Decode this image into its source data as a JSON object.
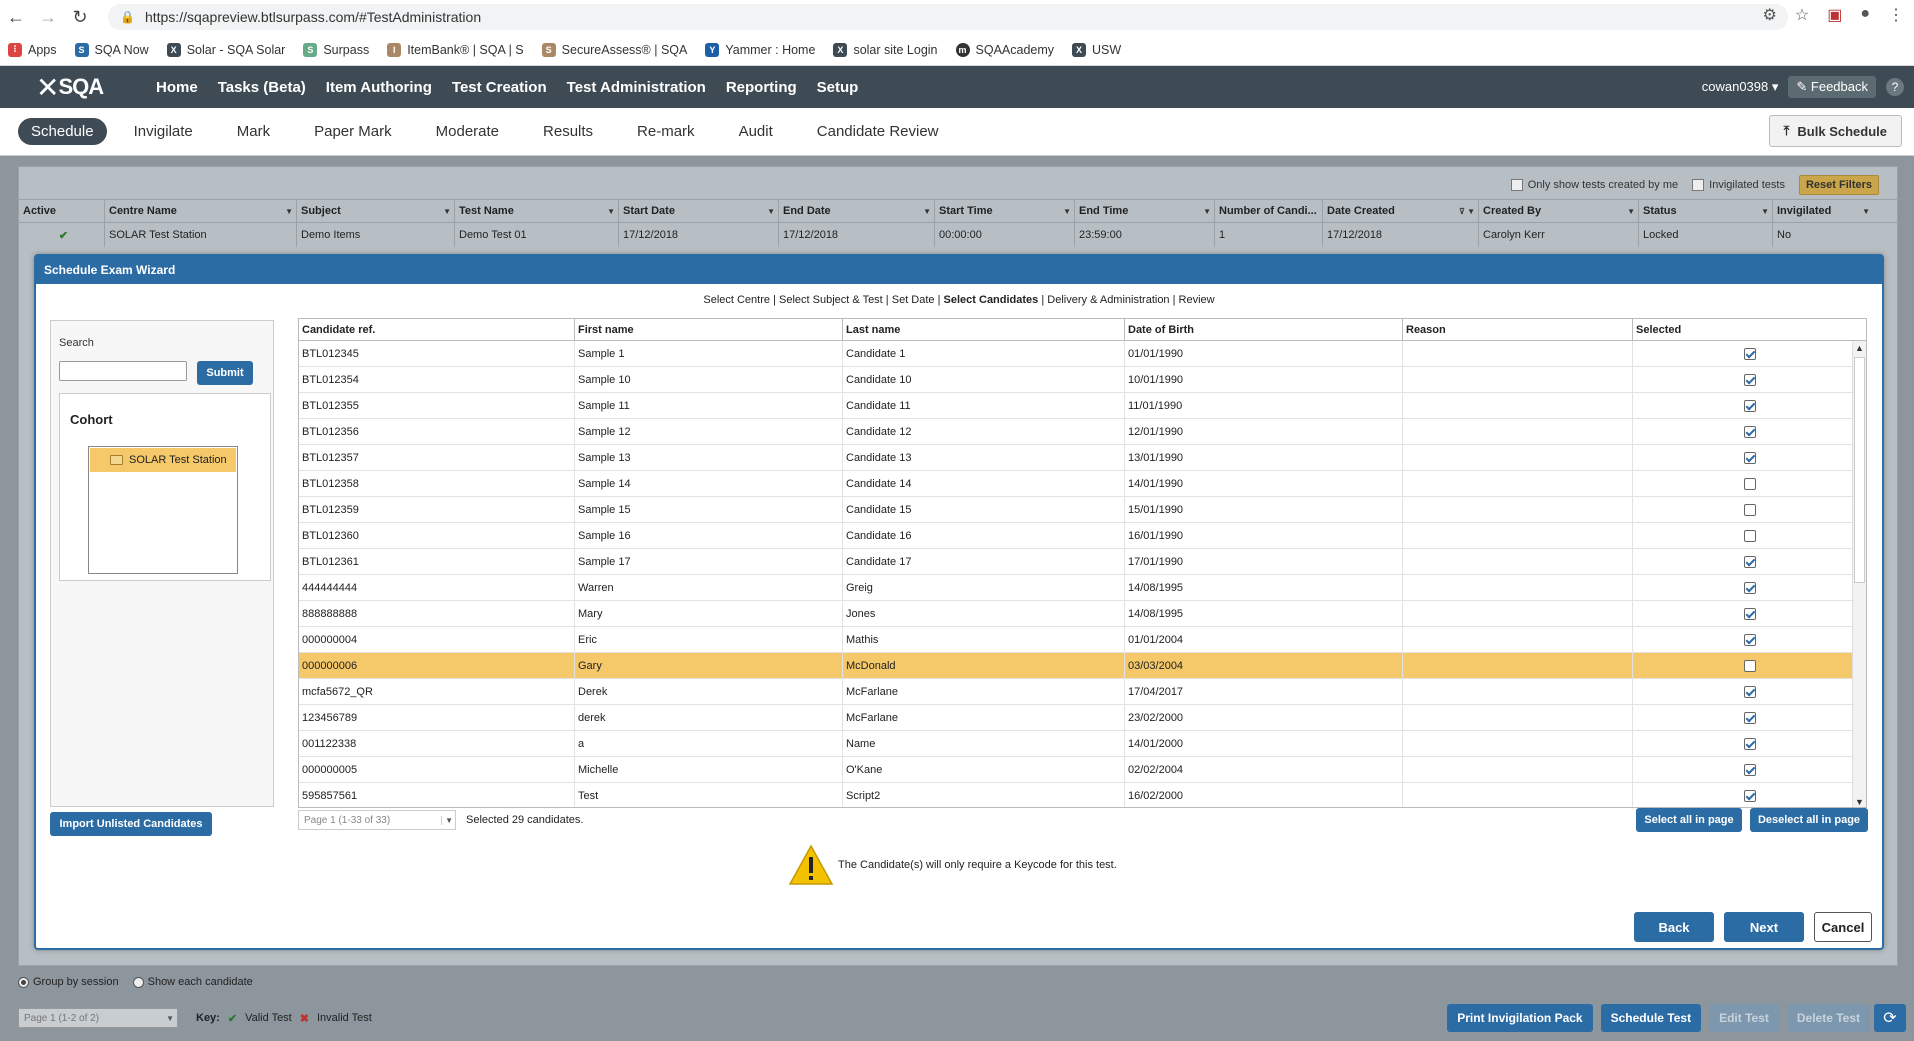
{
  "browser": {
    "url": "https://sqapreview.btlsurpass.com/#TestAdministration",
    "bookmarks": [
      "Apps",
      "SQA Now",
      "Solar - SQA Solar",
      "Surpass",
      "ItemBank® | SQA | S",
      "SecureAssess® | SQA",
      "Yammer : Home",
      "solar site Login",
      "SQAAcademy",
      "USW"
    ]
  },
  "header": {
    "logo": "SQA",
    "nav": [
      "Home",
      "Tasks (Beta)",
      "Item Authoring",
      "Test Creation",
      "Test Administration",
      "Reporting",
      "Setup"
    ],
    "user": "cowan0398 ▾",
    "feedback": "Feedback",
    "help": "?"
  },
  "subnav": {
    "tabs": [
      "Schedule",
      "Invigilate",
      "Mark",
      "Paper Mark",
      "Moderate",
      "Results",
      "Re-mark",
      "Audit",
      "Candidate Review"
    ],
    "bulk_schedule": "Bulk Schedule"
  },
  "filters": {
    "only_mine": "Only show tests created by me",
    "invigilated": "Invigilated tests",
    "reset": "Reset Filters"
  },
  "bg_table": {
    "columns": [
      "Active",
      "Centre Name",
      "Subject",
      "Test Name",
      "Start Date",
      "End Date",
      "Start Time",
      "End Time",
      "Number of Candi...",
      "Date Created",
      "Created By",
      "Status",
      "Invigilated"
    ],
    "row": [
      "✔",
      "SOLAR Test Station",
      "Demo Items",
      "Demo Test 01",
      "17/12/2018",
      "17/12/2018",
      "00:00:00",
      "23:59:00",
      "1",
      "17/12/2018",
      "Carolyn Kerr",
      "Locked",
      "No"
    ]
  },
  "wizard": {
    "title": "Schedule Exam Wizard",
    "steps": [
      "Select Centre",
      "Select Subject & Test",
      "Set Date",
      "Select Candidates",
      "Delivery & Administration",
      "Review"
    ],
    "current_step": "Select Candidates",
    "search_label": "Search",
    "submit": "Submit",
    "cohort_title": "Cohort",
    "cohort_item": "SOLAR Test Station",
    "import_btn": "Import Unlisted Candidates",
    "columns": [
      "Candidate ref.",
      "First name",
      "Last name",
      "Date of Birth",
      "Reason",
      "Selected"
    ],
    "rows": [
      {
        "ref": "BTL012345",
        "first": "Sample 1",
        "last": "Candidate 1",
        "dob": "01/01/1990",
        "reason": "",
        "selected": true
      },
      {
        "ref": "BTL012354",
        "first": "Sample 10",
        "last": "Candidate 10",
        "dob": "10/01/1990",
        "reason": "",
        "selected": true
      },
      {
        "ref": "BTL012355",
        "first": "Sample 11",
        "last": "Candidate 11",
        "dob": "11/01/1990",
        "reason": "",
        "selected": true
      },
      {
        "ref": "BTL012356",
        "first": "Sample 12",
        "last": "Candidate 12",
        "dob": "12/01/1990",
        "reason": "",
        "selected": true
      },
      {
        "ref": "BTL012357",
        "first": "Sample 13",
        "last": "Candidate 13",
        "dob": "13/01/1990",
        "reason": "",
        "selected": true
      },
      {
        "ref": "BTL012358",
        "first": "Sample 14",
        "last": "Candidate 14",
        "dob": "14/01/1990",
        "reason": "",
        "selected": false
      },
      {
        "ref": "BTL012359",
        "first": "Sample 15",
        "last": "Candidate 15",
        "dob": "15/01/1990",
        "reason": "",
        "selected": false
      },
      {
        "ref": "BTL012360",
        "first": "Sample 16",
        "last": "Candidate 16",
        "dob": "16/01/1990",
        "reason": "",
        "selected": false
      },
      {
        "ref": "BTL012361",
        "first": "Sample 17",
        "last": "Candidate 17",
        "dob": "17/01/1990",
        "reason": "",
        "selected": true
      },
      {
        "ref": "444444444",
        "first": "Warren",
        "last": "Greig",
        "dob": "14/08/1995",
        "reason": "",
        "selected": true
      },
      {
        "ref": "888888888",
        "first": "Mary",
        "last": "Jones",
        "dob": "14/08/1995",
        "reason": "",
        "selected": true
      },
      {
        "ref": "000000004",
        "first": "Eric",
        "last": "Mathis",
        "dob": "01/01/2004",
        "reason": "",
        "selected": true
      },
      {
        "ref": "000000006",
        "first": "Gary",
        "last": "McDonald",
        "dob": "03/03/2004",
        "reason": "",
        "selected": false,
        "highlight": true
      },
      {
        "ref": "mcfa5672_QR",
        "first": "Derek",
        "last": "McFarlane",
        "dob": "17/04/2017",
        "reason": "",
        "selected": true
      },
      {
        "ref": "123456789",
        "first": "derek",
        "last": "McFarlane",
        "dob": "23/02/2000",
        "reason": "",
        "selected": true
      },
      {
        "ref": "001122338",
        "first": "a",
        "last": "Name",
        "dob": "14/01/2000",
        "reason": "",
        "selected": true
      },
      {
        "ref": "000000005",
        "first": "Michelle",
        "last": "O'Kane",
        "dob": "02/02/2004",
        "reason": "",
        "selected": true
      },
      {
        "ref": "595857561",
        "first": "Test",
        "last": "Script2",
        "dob": "16/02/2000",
        "reason": "",
        "selected": true
      }
    ],
    "pager": "Page 1 (1-33 of 33)",
    "selected_count": "Selected 29 candidates.",
    "select_all": "Select all in page",
    "deselect_all": "Deselect all in page",
    "warning": "The Candidate(s) will only require a Keycode for this test.",
    "back": "Back",
    "next": "Next",
    "cancel": "Cancel"
  },
  "bottom": {
    "group_by_session": "Group by session",
    "show_each": "Show each candidate",
    "pager": "Page 1 (1-2 of 2)",
    "key_label": "Key:",
    "valid": "Valid Test",
    "invalid": "Invalid Test",
    "print_pack": "Print Invigilation Pack",
    "schedule_test": "Schedule Test",
    "edit_test": "Edit Test",
    "delete_test": "Delete Test"
  }
}
